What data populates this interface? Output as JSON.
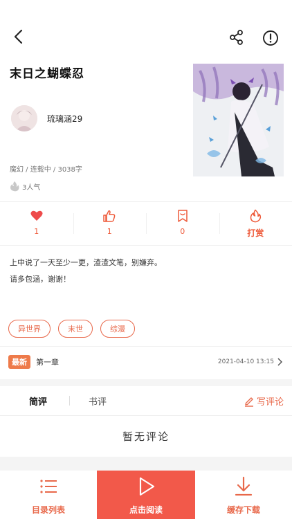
{
  "book": {
    "title": "末日之蝴蝶忍",
    "author": "琉璃涵29",
    "meta": "魔幻 / 连载中 / 3038字",
    "popularity": "3人气"
  },
  "stats": {
    "likes_heart": "1",
    "likes_thumb": "1",
    "collect": "0",
    "tip_label": "打赏"
  },
  "description": "上中说了一天至少一更，渣渣文笔，别嫌弃。\n  请多包涵，谢谢！",
  "tags": [
    "异世界",
    "末世",
    "综漫"
  ],
  "latest": {
    "badge": "最新",
    "chapter": "第一章",
    "date": "2021-04-10 13:15"
  },
  "comments": {
    "tab_short": "简评",
    "tab_book": "书评",
    "write_label": "写评论",
    "empty_text": "暂无评论"
  },
  "bottom": {
    "catalog": "目录列表",
    "read": "点击阅读",
    "download": "缓存下载"
  },
  "colors": {
    "accent": "#e8684a",
    "read_button": "#f2594a"
  }
}
